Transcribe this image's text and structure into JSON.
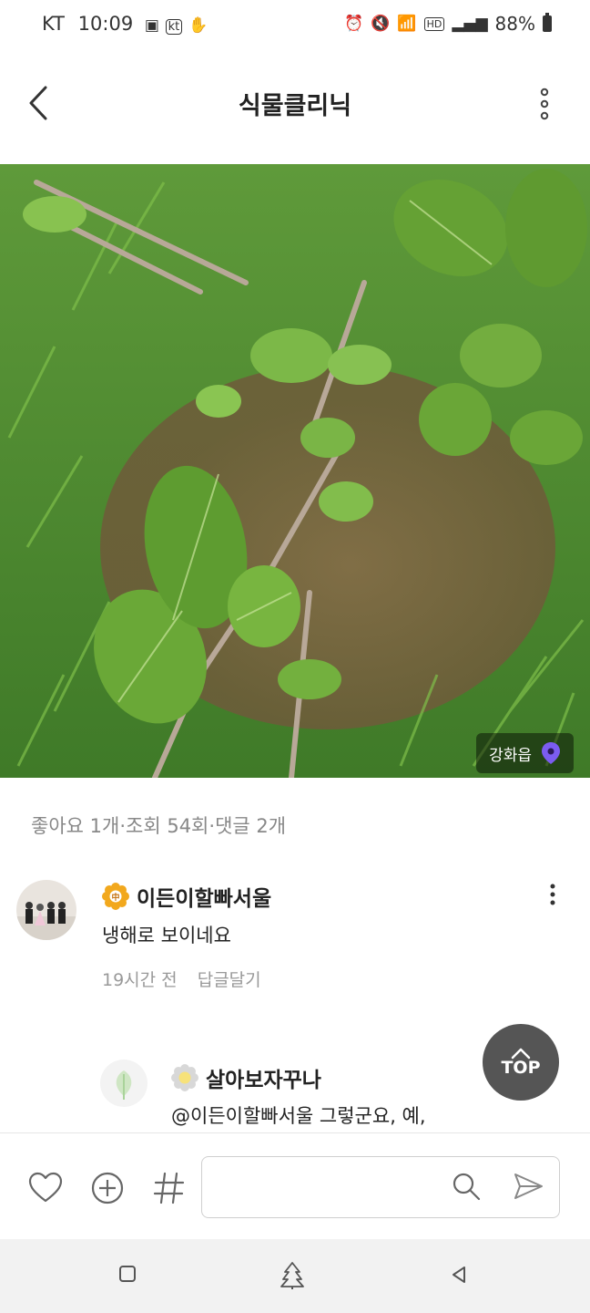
{
  "status": {
    "carrier": "KT",
    "time": "10:09",
    "battery": "88%",
    "icons": [
      "image-icon",
      "kt-icon",
      "hand-icon",
      "alarm-icon",
      "mute-icon",
      "wifi-icon",
      "hd-icon",
      "signal-icon",
      "battery-icon"
    ]
  },
  "header": {
    "title": "식물클리닉"
  },
  "photo": {
    "location": "강화읍"
  },
  "stats": {
    "likes": "좋아요 1개",
    "views": "조회 54회",
    "comments": "댓글 2개",
    "sep": "·"
  },
  "comments": [
    {
      "author": "이든이할빠서울",
      "text": "냉해로 보이네요",
      "time": "19시간 전",
      "reply": "답글달기"
    },
    {
      "author": "살아보자꾸나",
      "text": "@이든이할빠서울 그렇군요, 예,"
    }
  ],
  "top_button": {
    "label": "TOP"
  },
  "colors": {
    "accent_pin": "#7b5cf0",
    "badge_gold": "#f2a81d",
    "top_button_bg": "#555555"
  }
}
